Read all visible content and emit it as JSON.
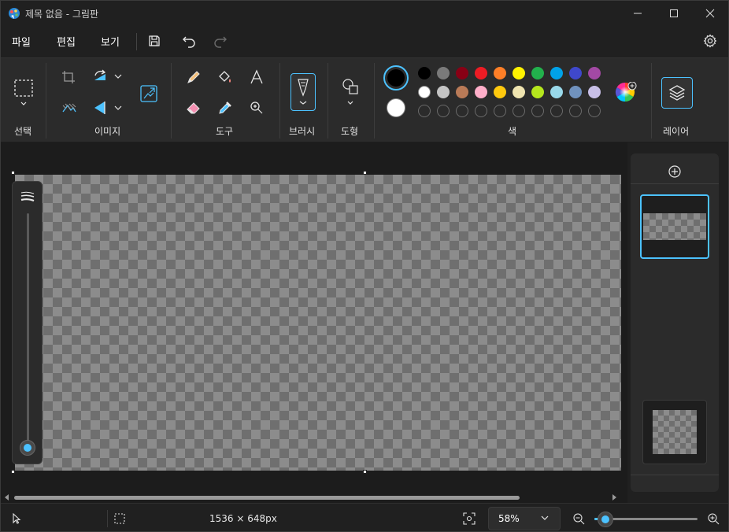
{
  "window": {
    "title": "제목 없음 - 그림판"
  },
  "menu": {
    "file": "파일",
    "edit": "편집",
    "view": "보기"
  },
  "ribbon": {
    "select_label": "선택",
    "image_label": "이미지",
    "tools_label": "도구",
    "brush_label": "브러시",
    "shapes_label": "도형",
    "colors_label": "색",
    "layers_label": "레이어"
  },
  "colors": {
    "primary": "#000000",
    "secondary": "#ffffff",
    "accent": "#4cc2ff",
    "palette_row1": [
      "#000000",
      "#7a7a7a",
      "#880015",
      "#ed1c24",
      "#ff7f27",
      "#fff200",
      "#22b14c",
      "#00a2e8",
      "#3f48cc",
      "#a349a4"
    ],
    "palette_row2": [
      "#ffffff",
      "#c3c3c3",
      "#b97a57",
      "#ffaec9",
      "#ffc90e",
      "#efe4b0",
      "#b5e61d",
      "#99d9ea",
      "#7092be",
      "#c8bfe7"
    ],
    "custom_slots": 10
  },
  "status": {
    "dimensions": "1536 × 648px",
    "zoom": "58%",
    "zoom_level": 0.58
  }
}
